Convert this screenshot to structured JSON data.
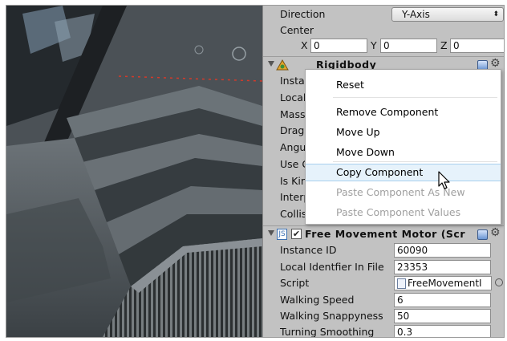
{
  "inspector": {
    "collider": {
      "direction_label": "Direction",
      "direction_value": "Y-Axis",
      "center_label": "Center",
      "center_x_label": "X",
      "center_x": "0",
      "center_y_label": "Y",
      "center_y": "0",
      "center_z_label": "Z",
      "center_z": "0"
    },
    "rigidbody": {
      "title": "Rigidbody",
      "labels": [
        "Instar",
        "Local",
        "Mass",
        "Drag",
        "Angul",
        "Use G",
        "Is Kin",
        "Interp",
        "Collis"
      ]
    },
    "motor": {
      "title": "Free Movement Motor (Scr",
      "instance_id_label": "Instance ID",
      "instance_id": "60090",
      "local_id_label": "Local Identfier In File",
      "local_id": "23353",
      "script_label": "Script",
      "script_value": "FreeMovementI",
      "walking_speed_label": "Walking Speed",
      "walking_speed": "6",
      "walking_snappyness_label": "Walking Snappyness",
      "walking_snappyness": "50",
      "turning_smoothing_label": "Turning Smoothing",
      "turning_smoothing": "0.3"
    }
  },
  "context_menu": {
    "reset": "Reset",
    "remove_component": "Remove Component",
    "move_up": "Move Up",
    "move_down": "Move Down",
    "copy_component": "Copy Component",
    "paste_as_new": "Paste Component As New",
    "paste_values": "Paste Component Values"
  },
  "colors": {
    "inspector_bg": "#c2c2c2",
    "menu_highlight": "#e6f2fb",
    "disabled_text": "#a0a0a0"
  }
}
